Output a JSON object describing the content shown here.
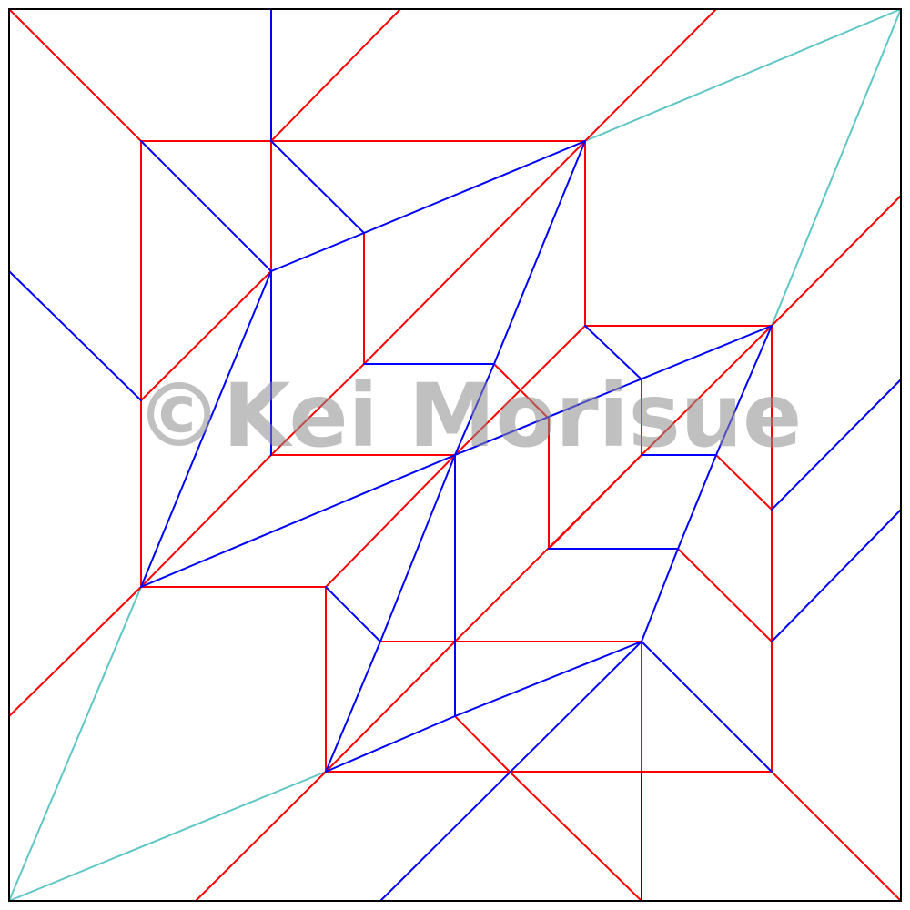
{
  "watermark": {
    "text": "©Kei Morisue"
  },
  "colors": {
    "border": "#000000",
    "mountain": "#ff0000",
    "valley": "#0000ff",
    "auxiliary": "#5fc6c6"
  }
}
